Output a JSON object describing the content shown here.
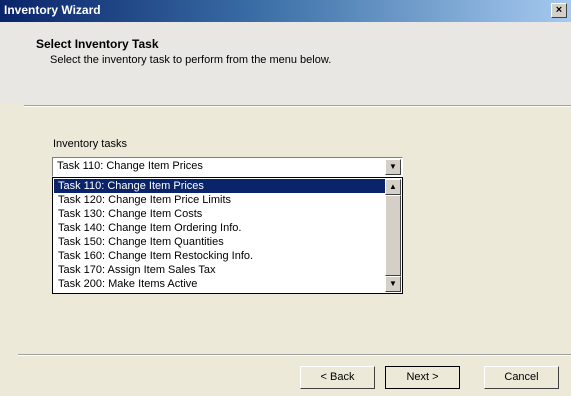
{
  "window": {
    "title": "Inventory Wizard",
    "close_glyph": "×"
  },
  "header": {
    "title": "Select Inventory Task",
    "subtitle": "Select the inventory task to perform from the menu below."
  },
  "tasks": {
    "label": "Inventory tasks",
    "selected_value": "Task 110: Change Item Prices",
    "options": [
      {
        "label": "Task 110: Change Item Prices",
        "selected": true
      },
      {
        "label": "Task 120: Change Item Price Limits",
        "selected": false
      },
      {
        "label": "Task 130: Change Item Costs",
        "selected": false
      },
      {
        "label": "Task 140: Change Item Ordering Info.",
        "selected": false
      },
      {
        "label": "Task 150: Change Item Quantities",
        "selected": false
      },
      {
        "label": "Task 160: Change Item Restocking Info.",
        "selected": false
      },
      {
        "label": "Task 170: Assign Item Sales Tax",
        "selected": false
      },
      {
        "label": "Task 200: Make Items Active",
        "selected": false
      }
    ]
  },
  "footer": {
    "back_label": "< Back",
    "next_label": "Next >",
    "cancel_label": "Cancel"
  },
  "icons": {
    "combo_arrow": "chevron-down-icon",
    "scroll_up": "scroll-up-icon",
    "scroll_down": "scroll-down-icon",
    "close": "close-icon"
  }
}
